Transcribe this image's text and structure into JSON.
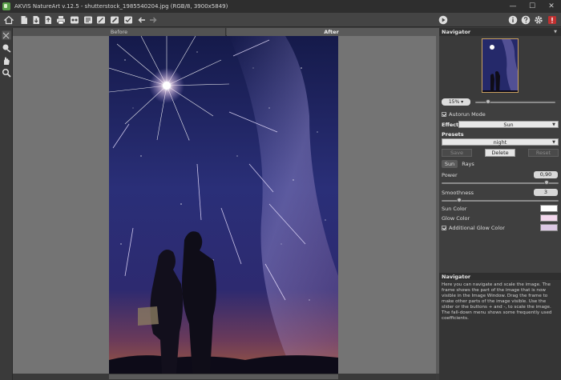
{
  "window": {
    "title": "AKVIS NatureArt v.12.5 - shutterstock_1985540204.jpg (RGB/8, 3900x5849)",
    "buttons": {
      "minimize": "—",
      "maximize": "☐",
      "close": "✕"
    }
  },
  "canvas": {
    "tabs": {
      "before": "Before",
      "after": "After"
    }
  },
  "navigator": {
    "header": "Navigator",
    "zoom": "15%",
    "zoom_level": 0.15,
    "zoom_slider_fraction": 0.16
  },
  "settings": {
    "autorun_label": "Autorun Mode",
    "autorun_checked": true,
    "effect_label": "Effect:",
    "effect_value": "Sun",
    "presets_label": "Presets",
    "preset_value": "night",
    "preset_buttons": {
      "save": "Save",
      "delete": "Delete",
      "reset": "Reset"
    },
    "tabs": {
      "sun": "Sun",
      "rays": "Rays"
    },
    "power_label": "Power",
    "power_value": "0,90",
    "power_fraction": 0.9,
    "smoothness_label": "Smoothness",
    "smoothness_value": "3",
    "smoothness_fraction": 0.15,
    "sun_color_label": "Sun Color",
    "sun_color": "#ffffff",
    "glow_color_label": "Glow Color",
    "glow_color": "#f4d8ee",
    "additional_glow_label": "Additional Glow Color",
    "additional_glow_checked": true,
    "additional_glow_color": "#dcc8e4"
  },
  "hints": {
    "header": "Navigator",
    "text": "Here you can navigate and scale the image. The frame shows the part of the image that is now visible in the Image Window. Drag the frame to make other parts of the image visible. Use the slider or the buttons + and -, to scale the image. The fall-down menu shows some frequently used coefficients."
  },
  "toolbar_icons": [
    "home-icon",
    "open-file-icon",
    "save-file-icon",
    "save-as-icon",
    "print-icon",
    "share-icon",
    "batch-icon",
    "edit-icon",
    "brush-icon",
    "preset-icon",
    "undo-arrow-icon",
    "redo-arrow-icon"
  ],
  "toolbar_right_icons": [
    "run-icon",
    "info-icon",
    "help-icon",
    "settings-gear-icon",
    "notification-icon"
  ],
  "left_tool_icons": [
    "crop-tool-icon",
    "paint-brush-tool-icon",
    "hand-tool-icon",
    "zoom-tool-icon"
  ]
}
